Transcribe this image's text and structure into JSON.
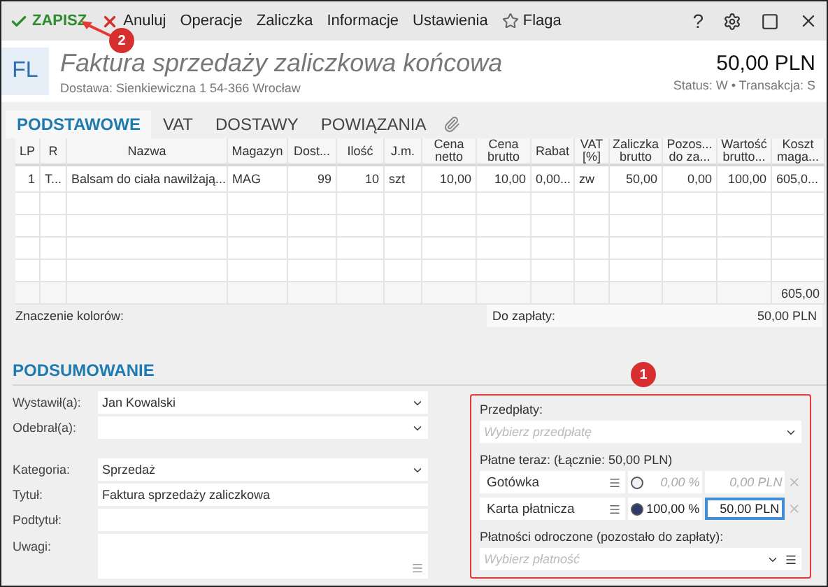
{
  "toolbar": {
    "items": [
      {
        "kind": "save",
        "label": "ZAPISZ"
      },
      {
        "kind": "cancel",
        "label": "Anuluj"
      },
      {
        "kind": "plain",
        "label": "Operacje"
      },
      {
        "kind": "plain",
        "label": "Zaliczka"
      },
      {
        "kind": "plain",
        "label": "Informacje"
      },
      {
        "kind": "plain",
        "label": "Ustawienia"
      },
      {
        "kind": "flag",
        "label": "Flaga"
      }
    ],
    "help": "?"
  },
  "header": {
    "badge": "FL",
    "title": "Faktura sprzedaży zaliczkowa końcowa",
    "address": "Dostawa: Sienkiewiczna 1 54-366 Wrocław",
    "amount": "50,00 PLN",
    "status": "Status:  W  •  Transakcja:  S"
  },
  "tabs": [
    {
      "label": "PODSTAWOWE",
      "selected": true
    },
    {
      "label": "VAT",
      "selected": false
    },
    {
      "label": "DOSTAWY",
      "selected": false
    },
    {
      "label": "POWIĄZANIA",
      "selected": false
    }
  ],
  "table": {
    "columns": [
      "LP",
      "R",
      "Nazwa",
      "Magazyn",
      "Dost...",
      "Ilość",
      "J.m.",
      "Cena netto",
      "Cena brutto",
      "Rabat",
      "VAT [%]",
      "Zaliczka brutto",
      "Pozos... do za...",
      "Wartość brutto...",
      "Koszt maga..."
    ],
    "rows": [
      [
        "1",
        "T...",
        "Balsam do ciała nawilżają...",
        "MAG",
        "99",
        "10",
        "szt",
        "10,00",
        "10,00",
        "0,00...",
        "zw",
        "50,00",
        "0,00",
        "100,00",
        "605,0..."
      ]
    ],
    "total": "605,00"
  },
  "legend": "Znaczenie kolorów:",
  "to_pay": {
    "label": "Do zapłaty:",
    "value": "50,00 PLN"
  },
  "summary": {
    "title": "PODSUMOWANIE",
    "fields": [
      {
        "label": "Wystawił(a):",
        "value": "Jan Kowalski",
        "kind": "select"
      },
      {
        "label": "Odebrał(a):",
        "kind": "select"
      },
      {
        "kind": "gap"
      },
      {
        "label": "Kategoria:",
        "value": "Sprzedaż",
        "kind": "select"
      },
      {
        "label": "Tytuł:",
        "value": "Faktura sprzedaży zaliczkowa",
        "kind": "text"
      },
      {
        "label": "Podtytuł:",
        "kind": "text"
      },
      {
        "label": "Uwagi:",
        "kind": "textarea"
      }
    ]
  },
  "payments": {
    "highlighted": true,
    "prepaid_label": "Przedpłaty:",
    "prepaid_placeholder": "Wybierz przedpłatę",
    "now_label": "Płatne teraz:  (Łącznie: 50,00 PLN)",
    "rows": [
      {
        "name": "Gotówka",
        "selected": false,
        "percent": "0,00 %",
        "amount": "0,00 PLN",
        "focused": false
      },
      {
        "name": "Karta płatnicza",
        "selected": true,
        "percent": "100,00 %",
        "amount": "50,00 PLN",
        "focused": true
      }
    ],
    "deferred_label": "Płatności odroczone (pozostało do zapłaty):",
    "deferred_placeholder": "Wybierz płatność"
  },
  "callouts": [
    {
      "number": "1",
      "arrow": false
    },
    {
      "number": "2",
      "arrow": true
    }
  ]
}
